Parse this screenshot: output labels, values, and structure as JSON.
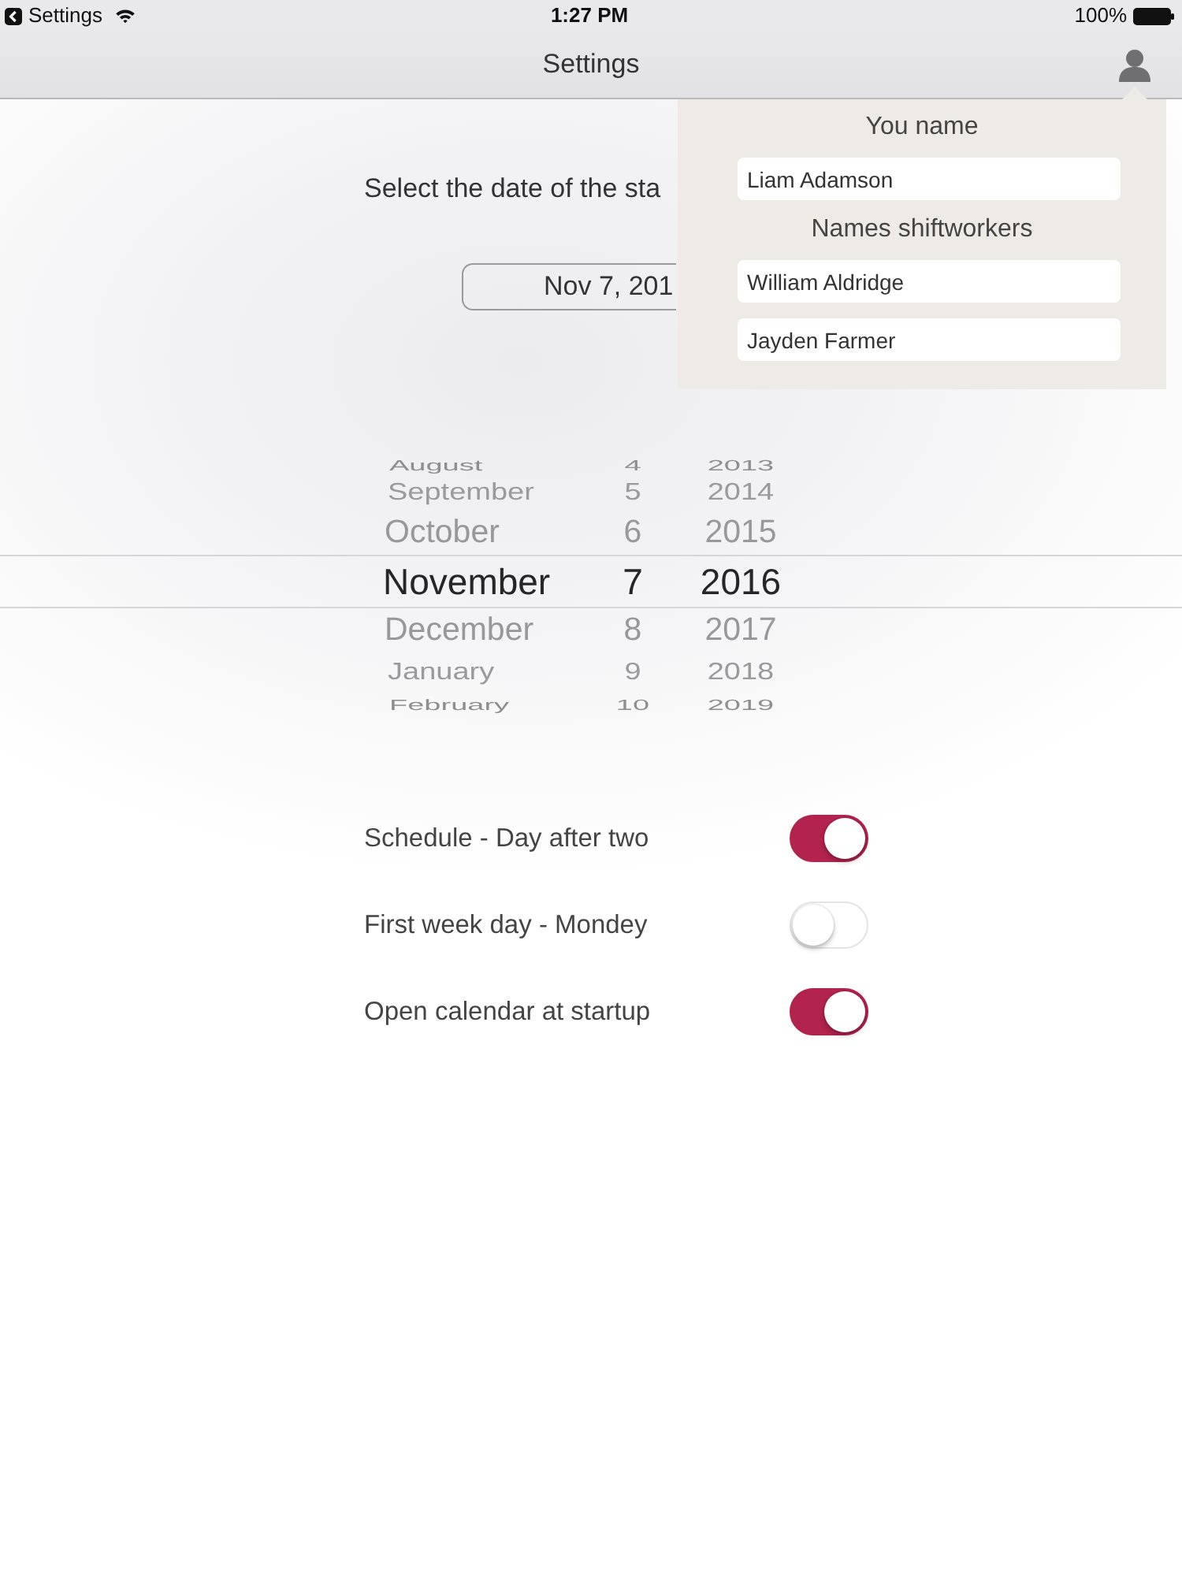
{
  "status_bar": {
    "back_label": "Settings",
    "time": "1:27 PM",
    "battery": "100%"
  },
  "nav_bar": {
    "title": "Settings"
  },
  "start_date": {
    "prompt": "Select the date of the sta",
    "value": "Nov 7, 201"
  },
  "date_picker": {
    "rows": [
      {
        "month": "August",
        "day": "4",
        "year": "2013",
        "selected": false
      },
      {
        "month": "September",
        "day": "5",
        "year": "2014",
        "selected": false
      },
      {
        "month": "October",
        "day": "6",
        "year": "2015",
        "selected": false
      },
      {
        "month": "November",
        "day": "7",
        "year": "2016",
        "selected": true
      },
      {
        "month": "December",
        "day": "8",
        "year": "2017",
        "selected": false
      },
      {
        "month": "January",
        "day": "9",
        "year": "2018",
        "selected": false
      },
      {
        "month": "February",
        "day": "10",
        "year": "2019",
        "selected": false
      }
    ]
  },
  "toggles": [
    {
      "label": "Schedule - Day after two",
      "on": true
    },
    {
      "label": "First week day - Mondey",
      "on": false
    },
    {
      "label": "Open calendar at startup",
      "on": true
    }
  ],
  "names_popover": {
    "user_label": "You name",
    "user_name": "Liam Adamson",
    "workers_label": "Names shiftworkers",
    "workers": [
      "William Aldridge",
      "Jayden Farmer"
    ]
  }
}
